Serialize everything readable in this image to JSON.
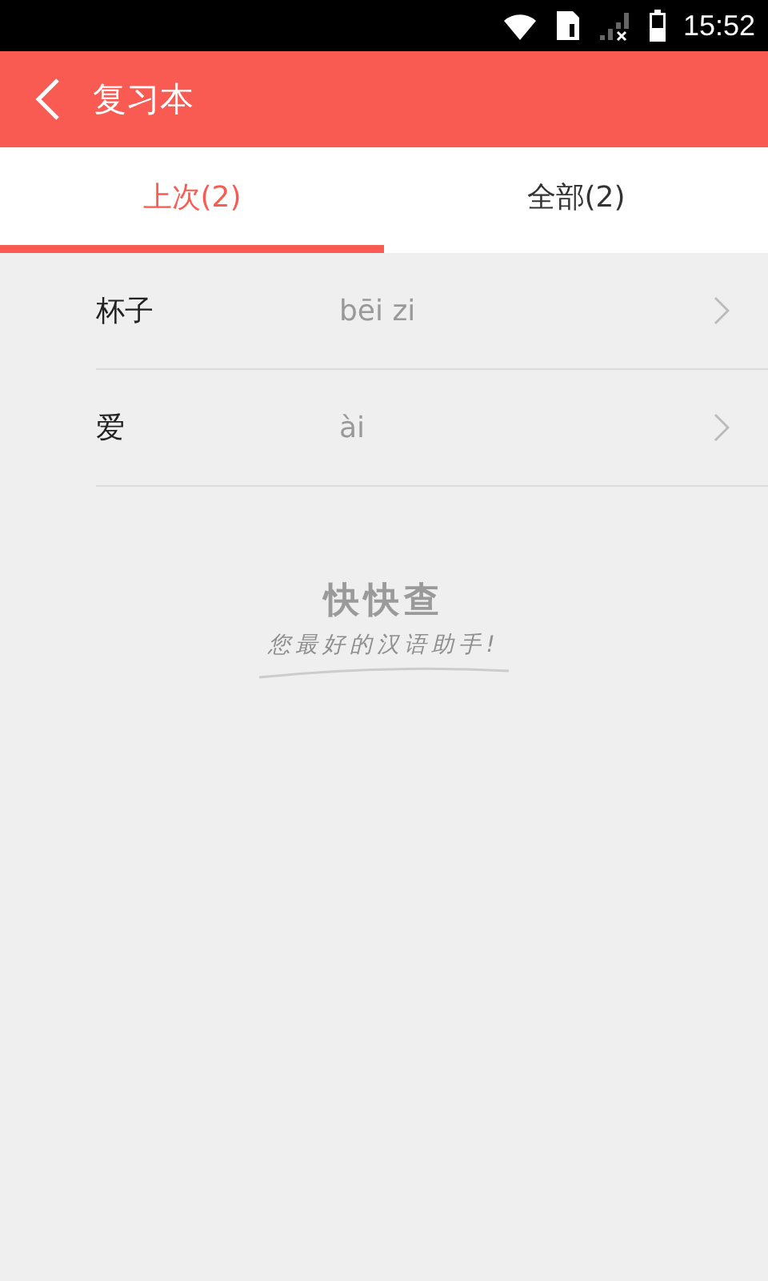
{
  "status_bar": {
    "time": "15:52"
  },
  "app_bar": {
    "title": "复习本"
  },
  "tabs": [
    {
      "label": "上次(2)",
      "selected": true
    },
    {
      "label": "全部(2)",
      "selected": false
    }
  ],
  "words": [
    {
      "word": "杯子",
      "pinyin": "bēi zi"
    },
    {
      "word": "爱",
      "pinyin": "ài"
    }
  ],
  "logo": {
    "name": "快快查",
    "slogan": "您最好的汉语助手!"
  }
}
